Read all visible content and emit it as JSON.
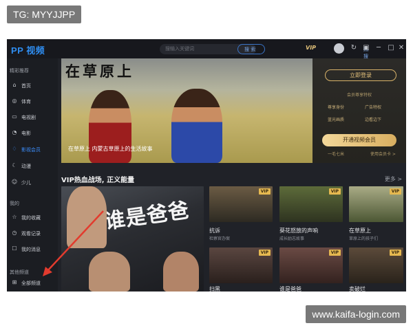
{
  "watermark": {
    "top": "TG: MYYJJPP",
    "bottom": "www.kaifa-login.com"
  },
  "app": {
    "logo": "PP 视频",
    "search_placeholder": "搜输入关键词",
    "hot_label": "热搜榜",
    "search_button": "搜 索",
    "vip_tag": "VIP"
  },
  "sidebar": {
    "featured_header": "精彩推荐",
    "items": [
      {
        "label": "首页",
        "icon": "home-icon"
      },
      {
        "label": "体育",
        "icon": "sports-icon"
      },
      {
        "label": "电视剧",
        "icon": "tv-icon"
      },
      {
        "label": "电影",
        "icon": "film-icon"
      },
      {
        "label": "影视会员",
        "icon": "vip-diamond-icon"
      },
      {
        "label": "动漫",
        "icon": "anime-icon"
      },
      {
        "label": "少儿",
        "icon": "kids-icon"
      }
    ],
    "mine_header": "我的",
    "mine_items": [
      {
        "label": "我的收藏",
        "icon": "favorite-icon"
      },
      {
        "label": "观看记录",
        "icon": "history-icon"
      },
      {
        "label": "我的消息",
        "icon": "message-icon"
      }
    ],
    "other_header": "其他频道",
    "other_items": [
      {
        "label": "全部频道",
        "icon": "grid-icon"
      }
    ]
  },
  "banner": {
    "title": "在草原上",
    "caption": "在草原上  内蒙古草原上的生活故事"
  },
  "vip_panel": {
    "login": "立即登录",
    "privilege": "会员尊享特权",
    "perks": [
      "尊享身份",
      "广告特权",
      "蓝光画质",
      "边看边下"
    ],
    "open": "开通视频会员",
    "left_tiny": "一毛七米",
    "right_tiny": "使用会员卡 >"
  },
  "section": {
    "title": "VIP热血战场, 正义能量",
    "more": "更多 >",
    "big_title": "谁是爸爸",
    "cards": [
      {
        "title": "抗诉",
        "sub": "检察官办案",
        "vip": "VIP"
      },
      {
        "title": "葵花怒放的声响",
        "sub": "成长励志故事",
        "vip": "VIP"
      },
      {
        "title": "在草原上",
        "sub": "草原上的孩子们",
        "vip": "VIP"
      },
      {
        "title": "扫黑",
        "sub": "",
        "vip": "VIP"
      },
      {
        "title": "谁是爸爸",
        "sub": "",
        "vip": "VIP"
      },
      {
        "title": "卖破烂",
        "sub": "",
        "vip": "VIP"
      }
    ]
  }
}
